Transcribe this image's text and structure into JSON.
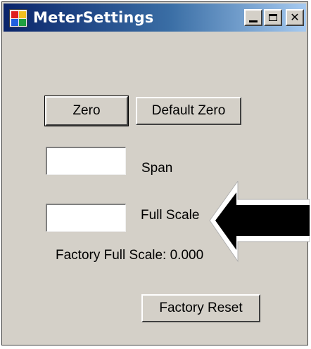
{
  "window": {
    "title": "MeterSettings",
    "icon": "app-icon",
    "caption_buttons": {
      "minimize_icon": "minimize-icon",
      "maximize_icon": "maximize-icon",
      "close_icon": "close-icon"
    }
  },
  "buttons": {
    "zero_label": "Zero",
    "default_zero_label": "Default Zero",
    "factory_reset_label": "Factory Reset"
  },
  "fields": {
    "span": {
      "label": "Span",
      "value": ""
    },
    "full_scale": {
      "label": "Full Scale",
      "value": ""
    }
  },
  "factory_full_scale": {
    "text": "Factory Full Scale:  0.000"
  },
  "annotation": {
    "arrow_icon": "left-arrow-icon",
    "arrow_color": "#000000",
    "arrow_outline_color": "#ffffff"
  },
  "colors": {
    "titlebar_start": "#0a246a",
    "titlebar_end": "#a6caf0",
    "window_bg": "#d4d0c8"
  }
}
